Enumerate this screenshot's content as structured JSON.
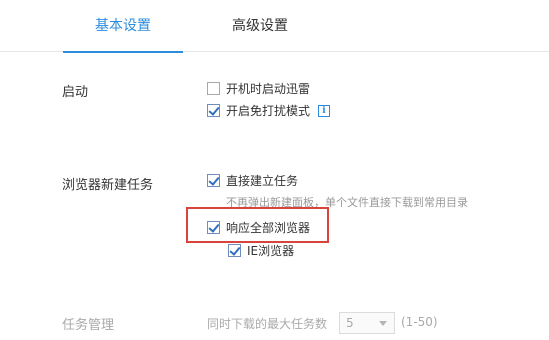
{
  "tabs": {
    "basic": "基本设置",
    "advanced": "高级设置"
  },
  "startup": {
    "label": "启动",
    "autostart": {
      "label": "开机时启动迅雷",
      "checked": false
    },
    "no_disturb": {
      "label": "开启免打扰模式",
      "checked": true,
      "info_icon": "i"
    }
  },
  "browser_task": {
    "label": "浏览器新建任务",
    "direct_create": {
      "label": "直接建立任务",
      "checked": true
    },
    "hint": "不再弹出新建面板，单个文件直接下载到常用目录",
    "respond_all": {
      "label": "响应全部浏览器",
      "checked": true
    },
    "ie_browser": {
      "label": "IE浏览器",
      "checked": true
    }
  },
  "task_management": {
    "label": "任务管理",
    "max_tasks_label": "同时下载的最大任务数",
    "max_tasks_value": "5",
    "range": "(1-50)"
  },
  "colors": {
    "accent": "#2c8dde",
    "highlight": "#d9443a"
  }
}
